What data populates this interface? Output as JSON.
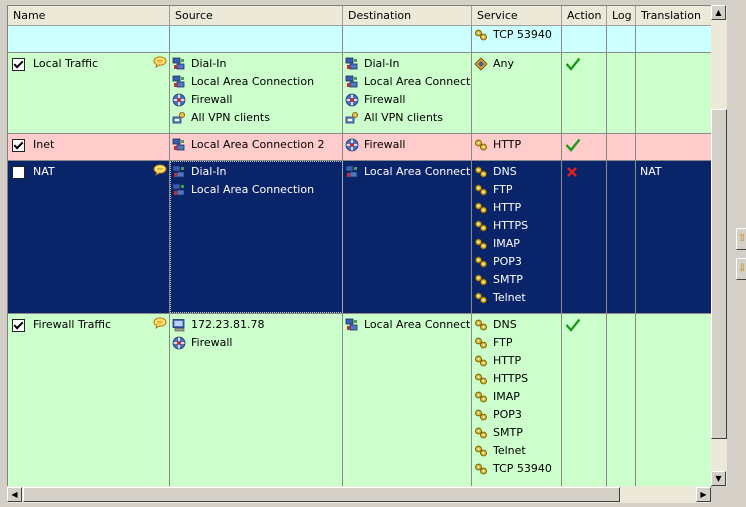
{
  "columns": [
    "Name",
    "Source",
    "Destination",
    "Service",
    "Action",
    "Log",
    "Translation"
  ],
  "colors": {
    "green_row": "#ccffcc",
    "red_row": "#ffcccc",
    "cyan_row": "#ccffff",
    "selected_row": "#0a246a",
    "allow": "#1a9a1a",
    "deny": "#e02020"
  },
  "rows": [
    {
      "id": "partial",
      "bg": "cyan",
      "name": "",
      "checked": null,
      "comment": false,
      "source": [],
      "destination": [],
      "service": [
        {
          "icon": "service-icon",
          "label": "TCP 53940"
        }
      ],
      "action": "",
      "log": "",
      "translation": ""
    },
    {
      "id": "local-traffic",
      "bg": "green",
      "name": "Local Traffic",
      "checked": true,
      "comment": true,
      "source": [
        {
          "icon": "network-icon",
          "label": "Dial-In"
        },
        {
          "icon": "network-icon",
          "label": "Local Area Connection"
        },
        {
          "icon": "firewall-icon",
          "label": "Firewall"
        },
        {
          "icon": "vpn-icon",
          "label": "All VPN clients"
        }
      ],
      "destination": [
        {
          "icon": "network-icon",
          "label": "Dial-In"
        },
        {
          "icon": "network-icon",
          "label": "Local Area Connection"
        },
        {
          "icon": "firewall-icon",
          "label": "Firewall"
        },
        {
          "icon": "vpn-icon",
          "label": "All VPN clients"
        }
      ],
      "service": [
        {
          "icon": "any-service-icon",
          "label": "Any"
        }
      ],
      "action": "allow",
      "log": "",
      "translation": ""
    },
    {
      "id": "inet",
      "bg": "red",
      "name": "Inet",
      "checked": true,
      "comment": false,
      "source": [
        {
          "icon": "network-icon",
          "label": "Local Area Connection 2"
        }
      ],
      "destination": [
        {
          "icon": "firewall-icon",
          "label": "Firewall"
        }
      ],
      "service": [
        {
          "icon": "service-icon",
          "label": "HTTP"
        }
      ],
      "action": "allow",
      "log": "",
      "translation": ""
    },
    {
      "id": "nat",
      "bg": "selected",
      "name": "NAT",
      "checked": false,
      "comment": true,
      "source": [
        {
          "icon": "network-icon",
          "label": "Dial-In"
        },
        {
          "icon": "network-icon",
          "label": "Local Area Connection"
        }
      ],
      "destination": [
        {
          "icon": "network-icon",
          "label": "Local Area Connection"
        }
      ],
      "service": [
        {
          "icon": "service-icon",
          "label": "DNS"
        },
        {
          "icon": "service-icon",
          "label": "FTP"
        },
        {
          "icon": "service-icon",
          "label": "HTTP"
        },
        {
          "icon": "service-icon",
          "label": "HTTPS"
        },
        {
          "icon": "service-icon",
          "label": "IMAP"
        },
        {
          "icon": "service-icon",
          "label": "POP3"
        },
        {
          "icon": "service-icon",
          "label": "SMTP"
        },
        {
          "icon": "service-icon",
          "label": "Telnet"
        }
      ],
      "action": "deny",
      "log": "",
      "translation": "NAT"
    },
    {
      "id": "firewall-traffic",
      "bg": "green",
      "name": "Firewall Traffic",
      "checked": true,
      "comment": true,
      "source": [
        {
          "icon": "computer-icon",
          "label": "172.23.81.78"
        },
        {
          "icon": "firewall-icon",
          "label": "Firewall"
        }
      ],
      "destination": [
        {
          "icon": "network-icon",
          "label": "Local Area Connection"
        }
      ],
      "service": [
        {
          "icon": "service-icon",
          "label": "DNS"
        },
        {
          "icon": "service-icon",
          "label": "FTP"
        },
        {
          "icon": "service-icon",
          "label": "HTTP"
        },
        {
          "icon": "service-icon",
          "label": "HTTPS"
        },
        {
          "icon": "service-icon",
          "label": "IMAP"
        },
        {
          "icon": "service-icon",
          "label": "POP3"
        },
        {
          "icon": "service-icon",
          "label": "SMTP"
        },
        {
          "icon": "service-icon",
          "label": "Telnet"
        },
        {
          "icon": "service-icon",
          "label": "TCP 53940"
        }
      ],
      "action": "allow",
      "log": "",
      "translation": ""
    }
  ]
}
